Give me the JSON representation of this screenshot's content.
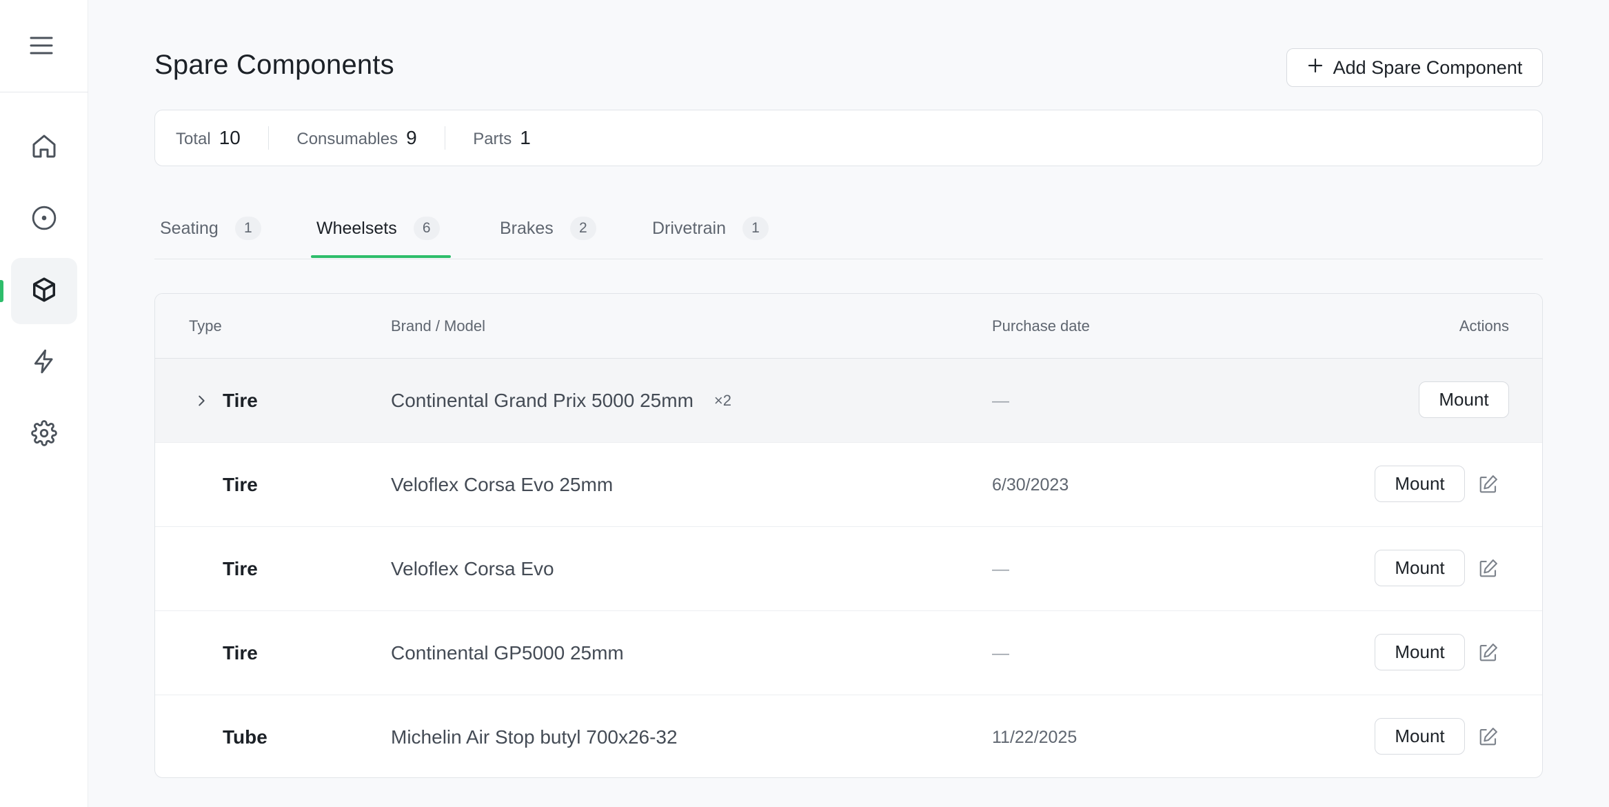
{
  "page": {
    "title": "Spare Components",
    "add_button_label": "Add Spare Component",
    "accent_color": "#2ebd6b"
  },
  "sidebar": {
    "menu_icon": "hamburger-icon",
    "items": [
      {
        "name": "home",
        "icon": "home-icon",
        "active": false
      },
      {
        "name": "rides",
        "icon": "circle-dot-icon",
        "active": false
      },
      {
        "name": "components",
        "icon": "box-icon",
        "active": true
      },
      {
        "name": "activity",
        "icon": "lightning-icon",
        "active": false
      },
      {
        "name": "settings",
        "icon": "gear-icon",
        "active": false
      }
    ]
  },
  "stats": [
    {
      "label": "Total",
      "value": "10"
    },
    {
      "label": "Consumables",
      "value": "9"
    },
    {
      "label": "Parts",
      "value": "1"
    }
  ],
  "tabs": [
    {
      "label": "Seating",
      "count": "1",
      "active": false
    },
    {
      "label": "Wheelsets",
      "count": "6",
      "active": true
    },
    {
      "label": "Brakes",
      "count": "2",
      "active": false
    },
    {
      "label": "Drivetrain",
      "count": "1",
      "active": false
    }
  ],
  "table": {
    "headers": {
      "type": "Type",
      "model": "Brand / Model",
      "date": "Purchase date",
      "actions": "Actions"
    },
    "mount_label": "Mount",
    "rows": [
      {
        "type": "Tire",
        "model": "Continental Grand Prix 5000 25mm",
        "multiplier": "×2",
        "date": "—",
        "group": true
      },
      {
        "type": "Tire",
        "model": "Veloflex Corsa Evo 25mm",
        "date": "6/30/2023"
      },
      {
        "type": "Tire",
        "model": "Veloflex Corsa Evo",
        "date": "—"
      },
      {
        "type": "Tire",
        "model": "Continental GP5000 25mm",
        "date": "—"
      },
      {
        "type": "Tube",
        "model": "Michelin Air Stop butyl 700x26-32",
        "date": "11/22/2025"
      }
    ]
  }
}
